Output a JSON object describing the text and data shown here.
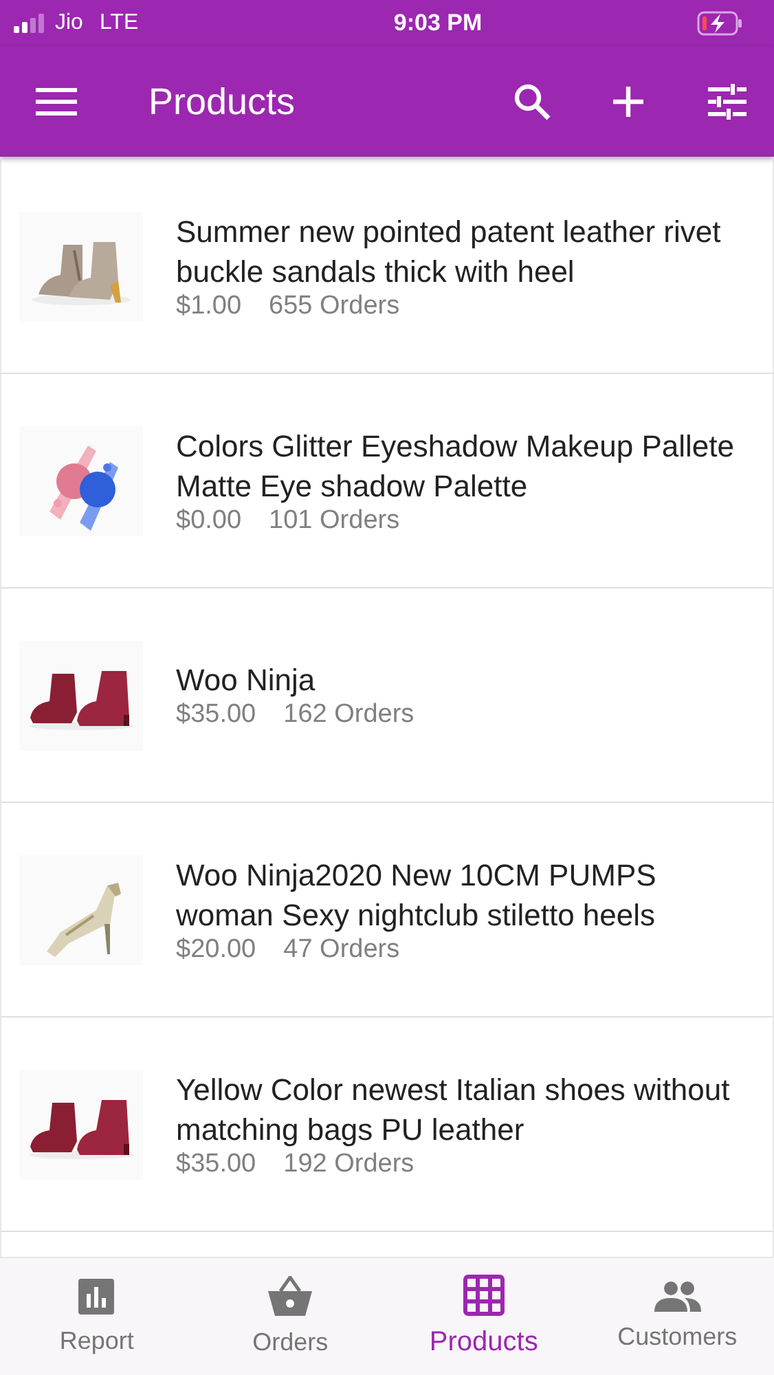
{
  "status_bar": {
    "carrier": "Jio",
    "network": "LTE",
    "time": "9:03 PM"
  },
  "app_bar": {
    "title": "Products"
  },
  "products": [
    {
      "name": "Summer new pointed patent leather rivet buckle sandals thick with heel",
      "price": "$1.00",
      "orders": "655 Orders"
    },
    {
      "name": "Colors Glitter Eyeshadow Makeup Pallete Matte Eye shadow Palette",
      "price": "$0.00",
      "orders": "101 Orders"
    },
    {
      "name": "Woo Ninja",
      "price": "$35.00",
      "orders": "162 Orders"
    },
    {
      "name": "Woo Ninja2020 New 10CM PUMPS woman Sexy nightclub stiletto heels",
      "price": "$20.00",
      "orders": "47 Orders"
    },
    {
      "name": "Yellow Color newest Italian shoes without matching bags PU leather",
      "price": "$35.00",
      "orders": "192 Orders"
    }
  ],
  "bottom_nav": [
    {
      "label": "Report",
      "kind": "report",
      "selected": false
    },
    {
      "label": "Orders",
      "kind": "orders",
      "selected": false
    },
    {
      "label": "Products",
      "kind": "products",
      "selected": true
    },
    {
      "label": "Customers",
      "kind": "customers",
      "selected": false
    }
  ]
}
